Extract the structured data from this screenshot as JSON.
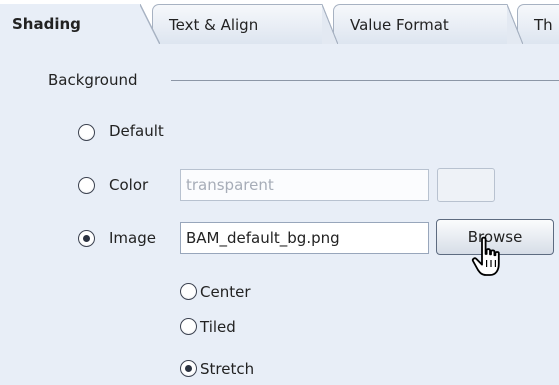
{
  "tabs": [
    {
      "label": "Shading",
      "active": true
    },
    {
      "label": "Text & Align",
      "active": false
    },
    {
      "label": "Value Format",
      "active": false
    },
    {
      "label": "Th",
      "active": false
    }
  ],
  "background_group": {
    "label": "Background",
    "options": [
      {
        "label": "Default",
        "checked": false
      },
      {
        "label": "Color",
        "checked": false
      },
      {
        "label": "Image",
        "checked": true
      }
    ],
    "color_value": "transparent",
    "image_value": "BAM_default_bg.png",
    "browse_label": "Browse"
  },
  "image_layout": {
    "options": [
      {
        "label": "Center",
        "checked": false
      },
      {
        "label": "Tiled",
        "checked": false
      },
      {
        "label": "Stretch",
        "checked": true
      }
    ]
  },
  "colors": {
    "panel_background": "#e8eef7",
    "tab_border": "#a7b2c2",
    "disabled_text": "#a7adb8"
  },
  "icons": [
    "radio-icon",
    "hand-pointer-icon"
  ]
}
